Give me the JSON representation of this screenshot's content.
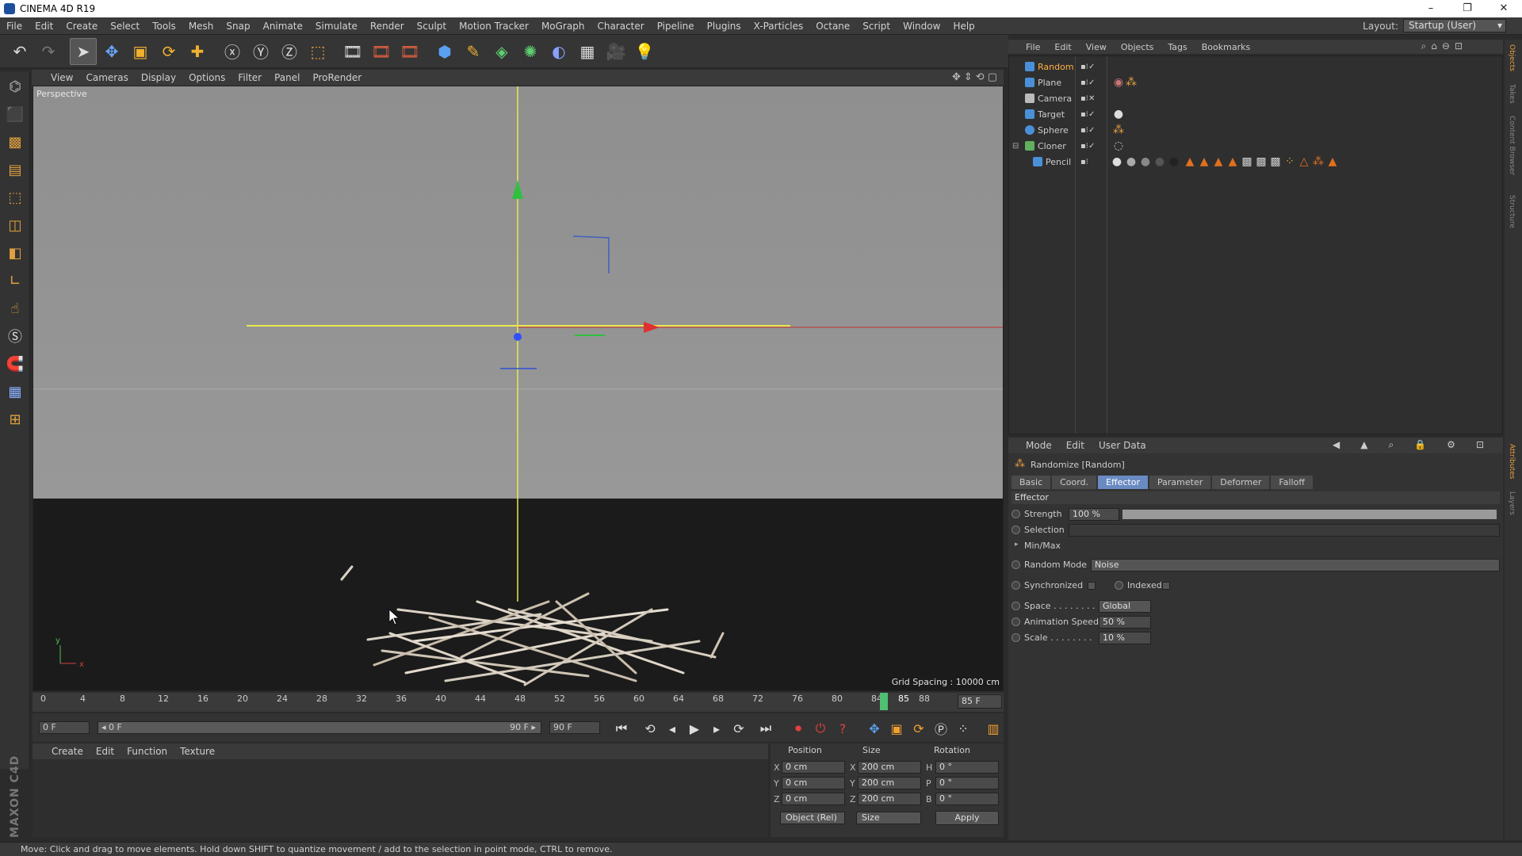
{
  "window": {
    "title": "CINEMA 4D R19",
    "min": "–",
    "max": "❐",
    "close": "✕"
  },
  "menubar": {
    "items": [
      "File",
      "Edit",
      "Create",
      "Select",
      "Tools",
      "Mesh",
      "Snap",
      "Animate",
      "Simulate",
      "Render",
      "Sculpt",
      "Motion Tracker",
      "MoGraph",
      "Character",
      "Pipeline",
      "Plugins",
      "X-Particles",
      "Octane",
      "Script",
      "Window",
      "Help"
    ],
    "layout_label": "Layout:",
    "layout_value": "Startup (User)"
  },
  "viewport": {
    "menu": [
      "View",
      "Cameras",
      "Display",
      "Options",
      "Filter",
      "Panel",
      "ProRender"
    ],
    "camera_label": "Perspective",
    "grid_spacing": "Grid Spacing : 10000 cm",
    "axis_y": "y",
    "axis_x": "x"
  },
  "timeline": {
    "ticks": [
      "0",
      "4",
      "8",
      "12",
      "16",
      "20",
      "24",
      "28",
      "32",
      "36",
      "40",
      "44",
      "48",
      "52",
      "56",
      "60",
      "64",
      "68",
      "72",
      "76",
      "80",
      "84",
      "85",
      "88"
    ],
    "playhead_frame": 85,
    "max_frame": 90,
    "current_frame_field": "85 F",
    "start_field": "0 F",
    "range_start": "◂ 0 F",
    "range_end": "90 F ▸",
    "end_field": "90 F"
  },
  "material_manager": {
    "menu": [
      "Create",
      "Edit",
      "Function",
      "Texture"
    ]
  },
  "coordinates": {
    "headers": {
      "position": "Position",
      "size": "Size",
      "rotation": "Rotation"
    },
    "rows": [
      {
        "axis": "X",
        "pos": "0 cm",
        "size_axis": "X",
        "size": "200 cm",
        "rot_axis": "H",
        "rot": "0 °"
      },
      {
        "axis": "Y",
        "pos": "0 cm",
        "size_axis": "Y",
        "size": "200 cm",
        "rot_axis": "P",
        "rot": "0 °"
      },
      {
        "axis": "Z",
        "pos": "0 cm",
        "size_axis": "Z",
        "size": "200 cm",
        "rot_axis": "B",
        "rot": "0 °"
      }
    ],
    "mode_select": "Object (Rel)",
    "size_select": "Size",
    "apply": "Apply"
  },
  "statusbar": "Move: Click and drag to move elements. Hold down SHIFT to quantize movement / add to the selection in point mode, CTRL to remove.",
  "object_manager": {
    "menu": [
      "File",
      "Edit",
      "View",
      "Objects",
      "Tags",
      "Bookmarks"
    ],
    "objects": [
      {
        "name": "Random",
        "selected": true,
        "icon_color": "#4a90d9"
      },
      {
        "name": "Plane",
        "selected": false,
        "icon_color": "#4a90d9"
      },
      {
        "name": "Camera",
        "selected": false,
        "icon_color": "#bbbbbb"
      },
      {
        "name": "Target",
        "selected": false,
        "icon_color": "#4a90d9"
      },
      {
        "name": "Sphere",
        "selected": false,
        "icon_color": "#4a90d9"
      },
      {
        "name": "Cloner",
        "selected": false,
        "icon_color": "#5fb05f"
      },
      {
        "name": "Pencil",
        "selected": false,
        "icon_color": "#4a90d9"
      }
    ]
  },
  "side_tabs": [
    "Objects",
    "Takes",
    "Content Browser",
    "Structure",
    "Attributes",
    "Layers"
  ],
  "attribute_manager": {
    "menu": [
      "Mode",
      "Edit",
      "User Data"
    ],
    "object_title": "Randomize [Random]",
    "tabs": [
      {
        "label": "Basic",
        "active": false
      },
      {
        "label": "Coord.",
        "active": false
      },
      {
        "label": "Effector",
        "active": true
      },
      {
        "label": "Parameter",
        "active": false
      },
      {
        "label": "Deformer",
        "active": false
      },
      {
        "label": "Falloff",
        "active": false
      }
    ],
    "section": "Effector",
    "strength_label": "Strength",
    "strength_value": "100 %",
    "strength_fraction": 1.0,
    "selection_label": "Selection",
    "minmax_label": "Min/Max",
    "random_mode_label": "Random Mode",
    "random_mode_value": "Noise",
    "synchronized_label": "Synchronized",
    "indexed_label": "Indexed",
    "space_label": "Space . . . . . . . .",
    "space_value": "Global",
    "anim_speed_label": "Animation Speed",
    "anim_speed_value": "50 %",
    "scale_label": "Scale . . . . . . . .",
    "scale_value": "10 %"
  }
}
